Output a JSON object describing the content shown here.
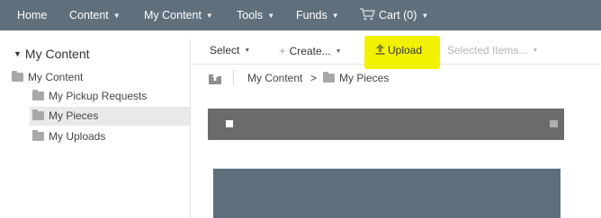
{
  "nav": {
    "home": "Home",
    "content": "Content",
    "my_content": "My Content",
    "tools": "Tools",
    "funds": "Funds",
    "cart": "Cart (0)"
  },
  "sidebar": {
    "title": "My Content",
    "root": "My Content",
    "items": [
      {
        "label": "My Pickup Requests",
        "selected": false
      },
      {
        "label": "My Pieces",
        "selected": true
      },
      {
        "label": "My Uploads",
        "selected": false
      }
    ]
  },
  "toolbar": {
    "select": "Select",
    "create": "Create...",
    "upload": "Upload",
    "selected_items": "Selected Items..."
  },
  "breadcrumb": {
    "root": "My Content",
    "separator": ">",
    "current": "My Pieces"
  },
  "colors": {
    "nav_bg": "#5f6f7c",
    "highlight": "#f2f200",
    "header_bar": "#6b6b6b",
    "tile": "#5e6f7c"
  },
  "icons": {
    "upload": "upload-arrow-icon",
    "cart": "cart-icon",
    "folder": "folder-icon",
    "up_level": "up-level-icon"
  }
}
